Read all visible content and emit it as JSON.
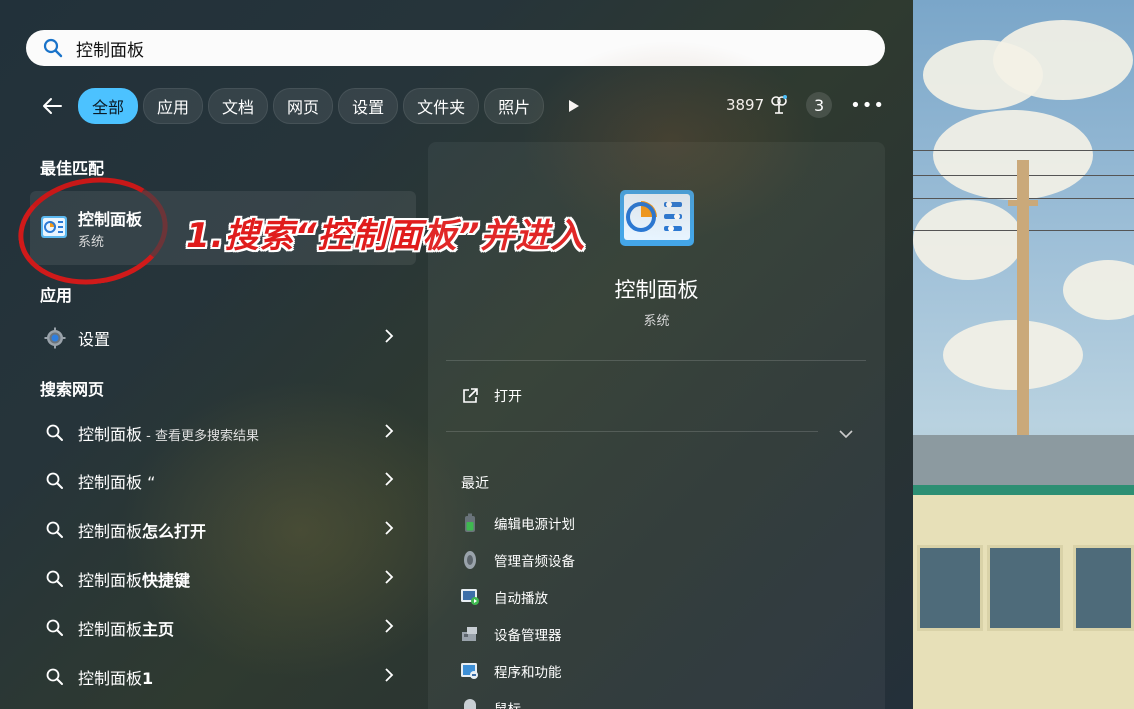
{
  "search": {
    "value": "控制面板"
  },
  "filters": {
    "chips": [
      "全部",
      "应用",
      "文档",
      "网页",
      "设置",
      "文件夹",
      "照片"
    ],
    "active_index": 0,
    "points": "3897",
    "badge_count": "3"
  },
  "best_match": {
    "section_title": "最佳匹配",
    "name": "控制面板",
    "type": "系统"
  },
  "annotation": "1.搜索“控制面板”并进入",
  "apps": {
    "section_title": "应用",
    "items": [
      {
        "label": "设置"
      }
    ]
  },
  "web": {
    "section_title": "搜索网页",
    "items": [
      {
        "label": "控制面板",
        "suffix": " - 查看更多搜索结果"
      },
      {
        "label": "控制面板 “",
        "suffix": ""
      },
      {
        "label": "控制面板",
        "suffix": "怎么打开"
      },
      {
        "label": "控制面板",
        "suffix": "快捷键"
      },
      {
        "label": "控制面板",
        "suffix": "主页"
      },
      {
        "label": "控制面板",
        "suffix": "1"
      }
    ]
  },
  "detail": {
    "name": "控制面板",
    "type": "系统",
    "open_label": "打开",
    "recent_title": "最近",
    "recent": [
      {
        "label": "编辑电源计划",
        "icon": "battery-icon"
      },
      {
        "label": "管理音频设备",
        "icon": "speaker-icon"
      },
      {
        "label": "自动播放",
        "icon": "autoplay-icon"
      },
      {
        "label": "设备管理器",
        "icon": "device-manager-icon"
      },
      {
        "label": "程序和功能",
        "icon": "programs-icon"
      },
      {
        "label": "鼠标",
        "icon": "mouse-icon"
      }
    ]
  },
  "colors": {
    "accent": "#4cc2ff",
    "annotation_red": "#e01c1c"
  }
}
